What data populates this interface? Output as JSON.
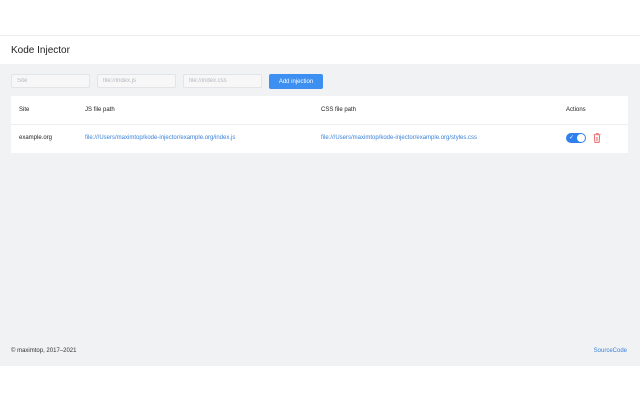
{
  "app": {
    "title": "Kode Injector"
  },
  "form": {
    "site_placeholder": "Site",
    "js_placeholder": "file://index.js",
    "css_placeholder": "file://index.css",
    "add_label": "Add injection"
  },
  "table": {
    "headers": {
      "site": "Site",
      "js": "JS file path",
      "css": "CSS file path",
      "actions": "Actions"
    },
    "rows": [
      {
        "site": "example.org",
        "js": "file:///Users/maximtop/kode-injector/example.org/index.js",
        "css": "file:///Users/maximtop/kode-injector/example.org/styles.css",
        "enabled": true
      }
    ]
  },
  "footer": {
    "copyright": "© maximtop, 2017–2021",
    "source_label": "SourceCode"
  },
  "colors": {
    "accent": "#3d8ff2",
    "link": "#3b82d9",
    "toggle_on": "#2f80ed",
    "delete": "#e5484d",
    "background": "#f1f2f4"
  },
  "icons": {
    "toggle": "check-icon",
    "delete": "trash-icon"
  }
}
